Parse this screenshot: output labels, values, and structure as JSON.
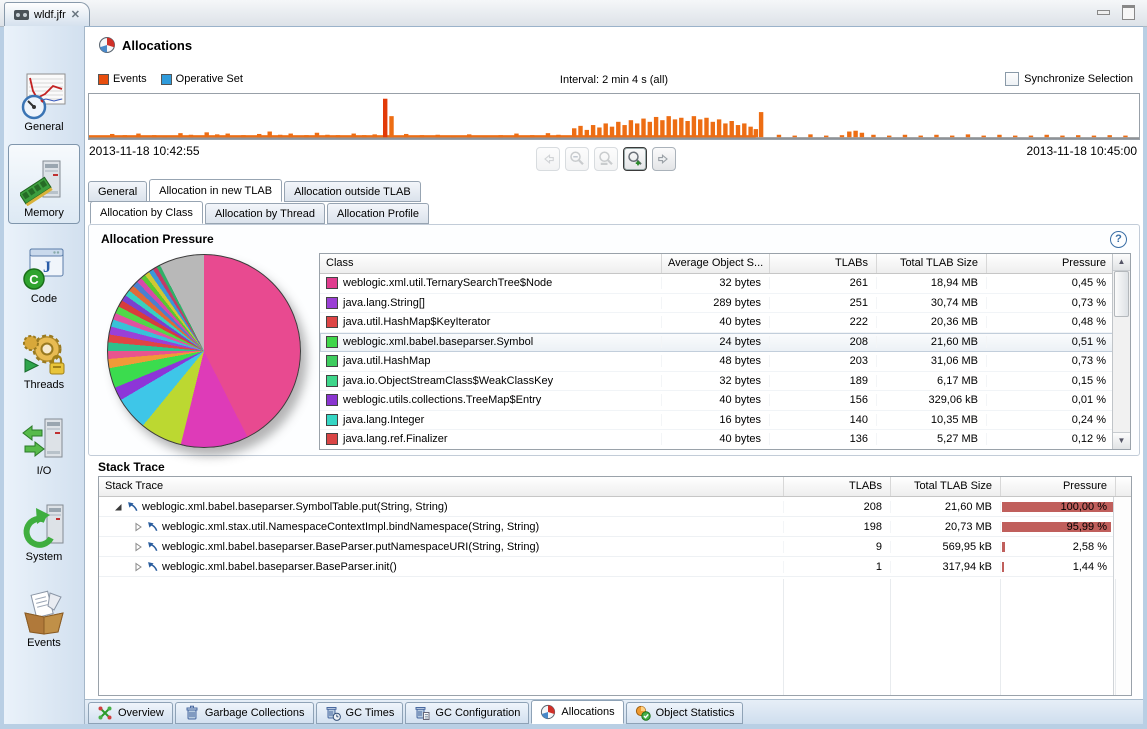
{
  "window": {
    "tab_title": "wldf.jfr"
  },
  "header": {
    "title": "Allocations"
  },
  "legend": {
    "events": {
      "label": "Events",
      "color": "#e84e0e"
    },
    "operative": {
      "label": "Operative Set",
      "color": "#2f9bdb"
    }
  },
  "toolbar": {
    "interval": "Interval: 2 min 4 s (all)",
    "sync_label": "Synchronize Selection",
    "sync_checked": false
  },
  "timeline": {
    "start_label": "2013-11-18 10:42:55",
    "end_label": "2013-11-18 10:45:00",
    "bar_color": "#ed6d13",
    "spike_color": "#e23a08",
    "baseline": {
      "from": 0,
      "to": 63.5
    },
    "bars": [
      [
        2,
        8
      ],
      [
        3.2,
        5
      ],
      [
        4.5,
        9
      ],
      [
        6,
        5
      ],
      [
        7,
        4
      ],
      [
        8.5,
        10
      ],
      [
        9.5,
        6
      ],
      [
        11,
        12
      ],
      [
        12,
        7
      ],
      [
        13,
        9
      ],
      [
        14.5,
        5
      ],
      [
        16,
        8
      ],
      [
        17,
        14
      ],
      [
        18,
        6
      ],
      [
        19,
        9
      ],
      [
        20.5,
        5
      ],
      [
        21.5,
        11
      ],
      [
        22.5,
        6
      ],
      [
        23.5,
        5
      ],
      [
        25,
        9
      ],
      [
        26,
        5
      ],
      [
        27,
        7
      ],
      [
        28,
        95
      ],
      [
        28.6,
        52
      ],
      [
        30,
        8
      ],
      [
        31.5,
        5
      ],
      [
        33,
        6
      ],
      [
        34.5,
        4
      ],
      [
        36,
        7
      ],
      [
        37.5,
        4
      ],
      [
        39,
        5
      ],
      [
        40.5,
        9
      ],
      [
        42,
        5
      ],
      [
        43.5,
        10
      ],
      [
        44.5,
        6
      ],
      [
        46,
        22
      ],
      [
        46.6,
        28
      ],
      [
        47.2,
        18
      ],
      [
        47.8,
        30
      ],
      [
        48.4,
        24
      ],
      [
        49,
        34
      ],
      [
        49.6,
        26
      ],
      [
        50.2,
        38
      ],
      [
        50.8,
        30
      ],
      [
        51.4,
        42
      ],
      [
        52,
        34
      ],
      [
        52.6,
        46
      ],
      [
        53.2,
        38
      ],
      [
        53.8,
        50
      ],
      [
        54.4,
        42
      ],
      [
        55,
        52
      ],
      [
        55.6,
        44
      ],
      [
        56.2,
        48
      ],
      [
        56.8,
        40
      ],
      [
        57.4,
        52
      ],
      [
        58,
        44
      ],
      [
        58.6,
        48
      ],
      [
        59.2,
        38
      ],
      [
        59.8,
        44
      ],
      [
        60.4,
        34
      ],
      [
        61,
        40
      ],
      [
        61.6,
        30
      ],
      [
        62.2,
        34
      ],
      [
        62.8,
        26
      ],
      [
        63.3,
        20
      ],
      [
        63.8,
        62
      ],
      [
        65.5,
        6
      ],
      [
        67,
        4
      ],
      [
        68.5,
        7
      ],
      [
        70,
        4
      ],
      [
        71.5,
        5
      ],
      [
        72.2,
        14
      ],
      [
        72.8,
        16
      ],
      [
        73.4,
        11
      ],
      [
        74.5,
        6
      ],
      [
        76,
        4
      ],
      [
        77.5,
        6
      ],
      [
        79,
        4
      ],
      [
        80.5,
        6
      ],
      [
        82,
        4
      ],
      [
        83.5,
        7
      ],
      [
        85,
        4
      ],
      [
        86.5,
        6
      ],
      [
        88,
        4
      ],
      [
        89.5,
        4
      ],
      [
        91,
        6
      ],
      [
        92.5,
        4
      ],
      [
        94,
        5
      ],
      [
        95.5,
        4
      ],
      [
        97,
        5
      ],
      [
        98.5,
        4
      ]
    ]
  },
  "sidebar": {
    "items": [
      {
        "label": "General",
        "icon": "general-icon",
        "selected": false
      },
      {
        "label": "Memory",
        "icon": "memory-icon",
        "selected": true
      },
      {
        "label": "Code",
        "icon": "code-icon",
        "selected": false
      },
      {
        "label": "Threads",
        "icon": "threads-icon",
        "selected": false
      },
      {
        "label": "I/O",
        "icon": "io-icon",
        "selected": false
      },
      {
        "label": "System",
        "icon": "system-icon",
        "selected": false
      },
      {
        "label": "Events",
        "icon": "events-icon",
        "selected": false
      }
    ]
  },
  "tabs_row1": [
    {
      "label": "General",
      "selected": false
    },
    {
      "label": "Allocation in new TLAB",
      "selected": true
    },
    {
      "label": "Allocation outside TLAB",
      "selected": false
    }
  ],
  "tabs_row2": [
    {
      "label": "Allocation by Class",
      "selected": true
    },
    {
      "label": "Allocation by Thread",
      "selected": false
    },
    {
      "label": "Allocation Profile",
      "selected": false
    }
  ],
  "pressure": {
    "title": "Allocation Pressure",
    "columns": [
      "Class",
      "Average Object S...",
      "TLABs",
      "Total TLAB Size",
      "Pressure"
    ],
    "rows": [
      {
        "color": "#e03c8e",
        "class": "weblogic.xml.util.TernarySearchTree$Node",
        "avg": "32 bytes",
        "tlabs": "261",
        "size": "18,94 MB",
        "pressure": "0,45 %",
        "selected": false
      },
      {
        "color": "#9a3fd4",
        "class": "java.lang.String[]",
        "avg": "289 bytes",
        "tlabs": "251",
        "size": "30,74 MB",
        "pressure": "0,73 %",
        "selected": false
      },
      {
        "color": "#dd4545",
        "class": "java.util.HashMap$KeyIterator",
        "avg": "40 bytes",
        "tlabs": "222",
        "size": "20,36 MB",
        "pressure": "0,48 %",
        "selected": false
      },
      {
        "color": "#3fd64a",
        "class": "weblogic.xml.babel.baseparser.Symbol",
        "avg": "24 bytes",
        "tlabs": "208",
        "size": "21,60 MB",
        "pressure": "0,51 %",
        "selected": true
      },
      {
        "color": "#3ecc5e",
        "class": "java.util.HashMap",
        "avg": "48 bytes",
        "tlabs": "203",
        "size": "31,06 MB",
        "pressure": "0,73 %",
        "selected": false
      },
      {
        "color": "#3ed68a",
        "class": "java.io.ObjectStreamClass$WeakClassKey",
        "avg": "32 bytes",
        "tlabs": "189",
        "size": "6,17 MB",
        "pressure": "0,15 %",
        "selected": false
      },
      {
        "color": "#8a35d0",
        "class": "weblogic.utils.collections.TreeMap$Entry",
        "avg": "40 bytes",
        "tlabs": "156",
        "size": "329,06 kB",
        "pressure": "0,01 %",
        "selected": false
      },
      {
        "color": "#35d6c4",
        "class": "java.lang.Integer",
        "avg": "16 bytes",
        "tlabs": "140",
        "size": "10,35 MB",
        "pressure": "0,24 %",
        "selected": false
      },
      {
        "color": "#d94545",
        "class": "java.lang.ref.Finalizer",
        "avg": "40 bytes",
        "tlabs": "136",
        "size": "5,27 MB",
        "pressure": "0,12 %",
        "selected": false
      },
      {
        "color": "#3a7ad8",
        "class": "",
        "avg": "",
        "tlabs": "",
        "size": "",
        "pressure": "",
        "selected": false
      }
    ]
  },
  "pie": {
    "slices": [
      {
        "color": "#e84a90",
        "value": 41.7
      },
      {
        "color": "#de3bb8",
        "value": 11.1
      },
      {
        "color": "#bcd831",
        "value": 6.9
      },
      {
        "color": "#3ec6e8",
        "value": 5.5
      },
      {
        "color": "#8d35d8",
        "value": 2.2
      },
      {
        "color": "#3bdc4e",
        "value": 3.3
      },
      {
        "color": "#f09a38",
        "value": 1.5
      },
      {
        "color": "#e8548e",
        "value": 1.3
      },
      {
        "color": "#2fc08c",
        "value": 1.4
      },
      {
        "color": "#e04444",
        "value": 1.3
      },
      {
        "color": "#9a40d8",
        "value": 1.3
      },
      {
        "color": "#38c2d8",
        "value": 1.2
      },
      {
        "color": "#e052a0",
        "value": 1.1
      },
      {
        "color": "#50d848",
        "value": 1.2
      },
      {
        "color": "#d83c3c",
        "value": 1.1
      },
      {
        "color": "#7a40d0",
        "value": 1.0
      },
      {
        "color": "#38d0c0",
        "value": 1.0
      },
      {
        "color": "#e06a38",
        "value": 1.0
      },
      {
        "color": "#4a80d0",
        "value": 0.9
      },
      {
        "color": "#d848a8",
        "value": 0.9
      },
      {
        "color": "#58c832",
        "value": 0.8
      },
      {
        "color": "#d0c832",
        "value": 0.8
      },
      {
        "color": "#3898d8",
        "value": 0.8
      },
      {
        "color": "#c23a68",
        "value": 0.7
      },
      {
        "color": "#30b068",
        "value": 0.6
      },
      {
        "color": "#b8b8b8",
        "value": 7.4
      }
    ]
  },
  "stack": {
    "title": "Stack Trace",
    "columns": [
      "Stack Trace",
      "TLABs",
      "Total TLAB Size",
      "Pressure"
    ],
    "bar_color": "#c05f5c",
    "rows": [
      {
        "level": 0,
        "expanded": true,
        "method": "weblogic.xml.babel.baseparser.SymbolTable.put(String, String)",
        "tlabs": "208",
        "size": "21,60 MB",
        "pressure": "100,00 %",
        "bar": 100
      },
      {
        "level": 1,
        "expanded": false,
        "method": "weblogic.xml.stax.util.NamespaceContextImpl.bindNamespace(String, String)",
        "tlabs": "198",
        "size": "20,73 MB",
        "pressure": "95,99 %",
        "bar": 96
      },
      {
        "level": 1,
        "expanded": false,
        "method": "weblogic.xml.babel.baseparser.BaseParser.putNamespaceURI(String, String)",
        "tlabs": "9",
        "size": "569,95 kB",
        "pressure": "2,58 %",
        "bar": 2.6
      },
      {
        "level": 1,
        "expanded": false,
        "method": "weblogic.xml.babel.baseparser.BaseParser.init()",
        "tlabs": "1",
        "size": "317,94 kB",
        "pressure": "1,44 %",
        "bar": 1.4
      }
    ]
  },
  "bottom_tabs": [
    {
      "label": "Overview",
      "icon": "overview-icon",
      "selected": false
    },
    {
      "label": "Garbage Collections",
      "icon": "gc-icon",
      "selected": false
    },
    {
      "label": "GC Times",
      "icon": "gc-times-icon",
      "selected": false
    },
    {
      "label": "GC Configuration",
      "icon": "gc-config-icon",
      "selected": false
    },
    {
      "label": "Allocations",
      "icon": "allocations-icon",
      "selected": true
    },
    {
      "label": "Object Statistics",
      "icon": "object-stats-icon",
      "selected": false
    }
  ]
}
